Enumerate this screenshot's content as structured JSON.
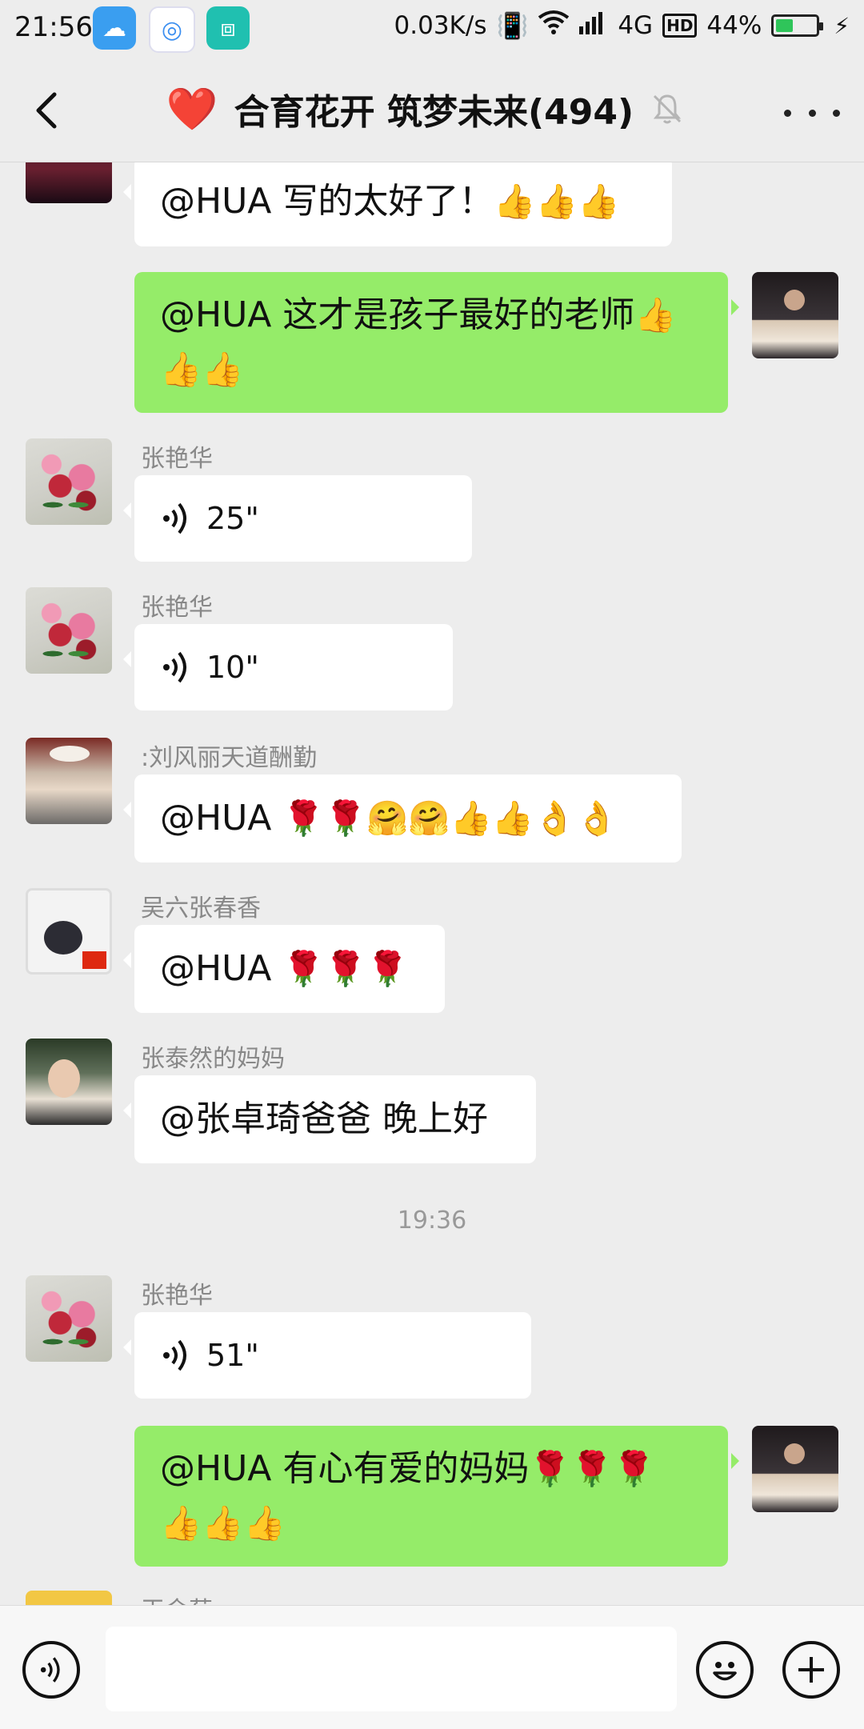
{
  "status_bar": {
    "time": "21:56",
    "net_speed": "0.03K/s",
    "network": "4G",
    "hd": "HD",
    "battery": "44%",
    "battery_level": 0.44,
    "icons": [
      "weather-icon",
      "browser-icon",
      "scanner-icon",
      "vibrate-icon",
      "wifi-icon",
      "signal-icon",
      "charging-icon"
    ]
  },
  "header": {
    "title": "合育花开 筑梦未来(494)",
    "heart": "❤️",
    "icons": [
      "back-icon",
      "mute-bell-icon",
      "more-icon"
    ]
  },
  "messages": {
    "m1": {
      "text": "@HUA  写的太好了！",
      "emoji": "👍👍👍"
    },
    "m2": {
      "text": "@HUA  这才是孩子最好的老师",
      "emoji_a": "👍",
      "emoji_b": "👍👍"
    },
    "m3": {
      "sender": "张艳华",
      "duration": "25\""
    },
    "m4": {
      "sender": "张艳华",
      "duration": "10\""
    },
    "m5": {
      "sender": ":刘风丽天道酬勤",
      "text": "@HUA",
      "emoji": "🌹🌹🤗🤗👍👍👌👌"
    },
    "m6": {
      "sender": "吴六张春香",
      "text": "@HUA",
      "emoji": "🌹🌹🌹"
    },
    "m7": {
      "sender": "张泰然的妈妈",
      "text": "@张卓琦爸爸  晚上好"
    },
    "time_separator": "19:36",
    "m8": {
      "sender": "张艳华",
      "duration": "51\""
    },
    "m9": {
      "text": "@HUA  有心有爱的妈妈",
      "emoji_a": "🌹🌹🌹",
      "emoji_b": "👍👍👍"
    },
    "m10": {
      "sender": "王金菊"
    }
  },
  "input_bar": {
    "icons": [
      "voice-input-icon",
      "emoji-icon",
      "plus-icon"
    ],
    "placeholder": ""
  }
}
